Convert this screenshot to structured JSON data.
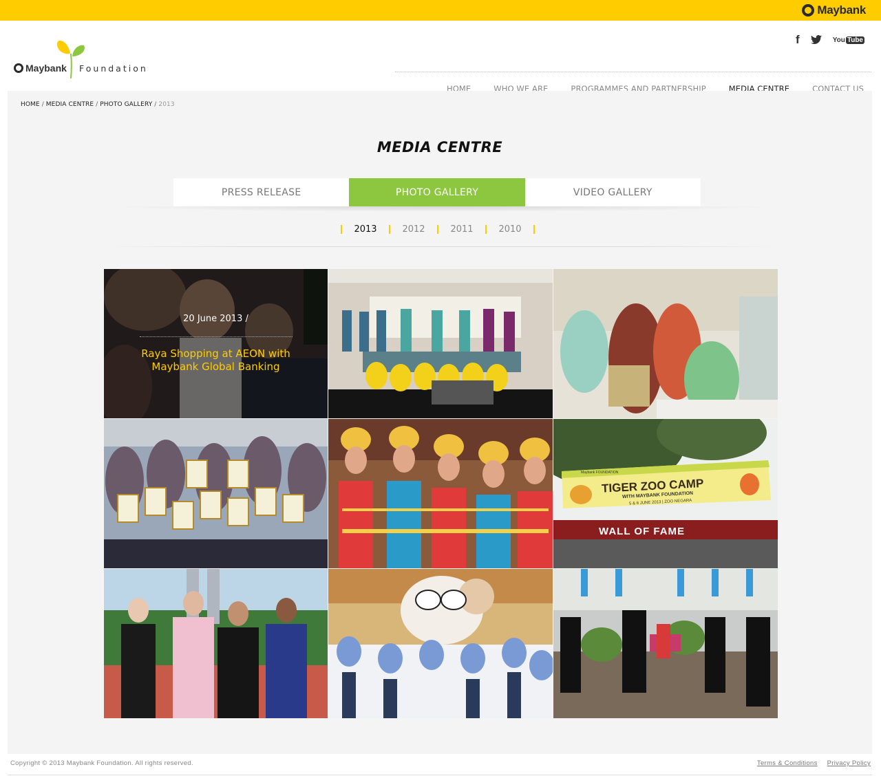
{
  "brand": {
    "corporate_name": "Maybank",
    "foundation_name": "Maybank",
    "foundation_suffix": "Foundation",
    "accent_yellow": "#ffcc00",
    "accent_green": "#8dc63f"
  },
  "social": {
    "facebook": "f",
    "twitter_icon": "twitter-bird-icon",
    "youtube_you": "You",
    "youtube_tube": "Tube"
  },
  "nav": [
    {
      "label": "HOME",
      "active": false
    },
    {
      "label": "WHO WE ARE",
      "active": false
    },
    {
      "label": "PROGRAMMES AND PARTNERSHIP",
      "active": false
    },
    {
      "label": "MEDIA CENTRE",
      "active": true
    },
    {
      "label": "CONTACT US",
      "active": false
    }
  ],
  "breadcrumb": {
    "items": [
      "HOME",
      "MEDIA CENTRE",
      "PHOTO GALLERY"
    ],
    "current": "2013",
    "separator": "/"
  },
  "page_title": "MEDIA CENTRE",
  "tabs": [
    {
      "label": "PRESS RELEASE",
      "active": false
    },
    {
      "label": "PHOTO GALLERY",
      "active": true
    },
    {
      "label": "VIDEO GALLERY",
      "active": false
    }
  ],
  "years": [
    {
      "label": "2013",
      "active": true
    },
    {
      "label": "2012",
      "active": false
    },
    {
      "label": "2011",
      "active": false
    },
    {
      "label": "2010",
      "active": false
    }
  ],
  "gallery": {
    "hovered": {
      "date": "20 June 2013 /",
      "title": "Raya Shopping at AEON with Maybank Global Banking"
    },
    "zoo_banner": {
      "small": "Maybank FOUNDATION",
      "title": "TIGER ZOO CAMP",
      "sub": "WITH MAYBANK FOUNDATION",
      "date": "5 & 6 JUNE 2013 | ZOO NEGARA",
      "wall": "WALL OF FAME"
    }
  },
  "footer": {
    "copyright": "Copyright © 2013 Maybank Foundation. All rights reserved.",
    "terms": "Terms & Conditions",
    "privacy": "Privacy Policy"
  }
}
